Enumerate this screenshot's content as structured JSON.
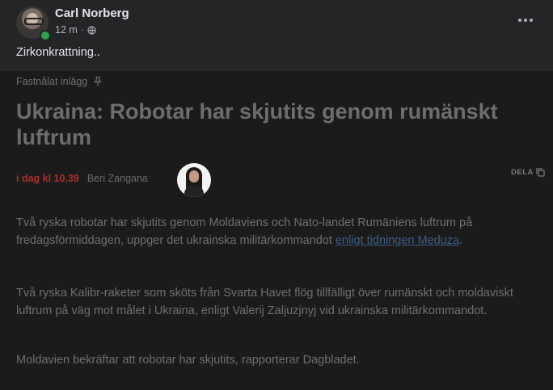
{
  "post": {
    "author": "Carl Norberg",
    "time": "12 m",
    "separator": "·",
    "text": "Zirkonkrattning..",
    "more_icon": "more-horizontal-icon",
    "privacy_icon": "globe-icon"
  },
  "article": {
    "pinned_label": "Fastnålat inlägg",
    "headline": "Ukraina: Robotar har skjutits genom rumänskt luftrum",
    "time": "i dag kl 10.39",
    "reporter": "Beri Zangana",
    "share_label": "DELA",
    "paragraphs": {
      "p1_text": "Två ryska robotar har skjutits genom Moldaviens och Nato-landet Rumäniens luftrum på fredagsförmiddagen, uppger det ukrainska militärkommandot ",
      "p1_link": "enligt tidningen Meduza",
      "p1_end": ".",
      "p2": "Två ryska Kalibr-raketer som sköts från Svarta Havet flög tillfälligt över rumänskt och moldaviskt luftrum på väg mot målet i Ukraina, enligt Valerij Zaljuzjnyj vid ukrainska militärkommandot.",
      "p3": "Moldavien bekräftar att robotar har skjutits, rapporterar Dagbladet."
    }
  },
  "colors": {
    "background": "#242526",
    "article_background": "#1b1b1c",
    "time_red": "#a8302d",
    "link_blue": "#3c5e84",
    "online_green": "#31a24c"
  }
}
